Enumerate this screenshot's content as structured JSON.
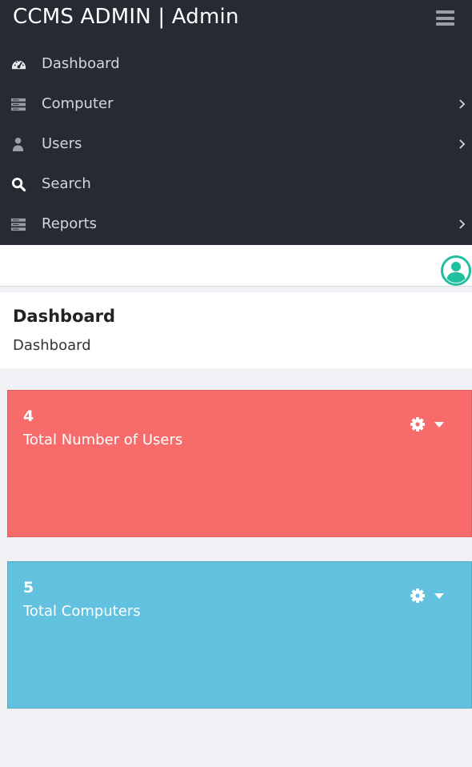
{
  "app": {
    "brand": "CCMS ADMIN | Admin"
  },
  "nav": {
    "items": [
      {
        "label": "Dashboard",
        "icon": "dashboard-icon"
      },
      {
        "label": "Computer",
        "icon": "server-icon",
        "has_submenu": true
      },
      {
        "label": "Users",
        "icon": "user-icon",
        "has_submenu": true
      },
      {
        "label": "Search",
        "icon": "search-icon"
      },
      {
        "label": "Reports",
        "icon": "server-icon",
        "has_submenu": true
      }
    ]
  },
  "topbar": {
    "avatar_icon": "user-circle-icon",
    "avatar_color": "#1fbfa0"
  },
  "page": {
    "title": "Dashboard",
    "breadcrumb": "Dashboard"
  },
  "cards": [
    {
      "value": "4",
      "label": "Total Number of Users",
      "color": "#f76b6b",
      "menu_icon": "gear-icon"
    },
    {
      "value": "5",
      "label": "Total Computers",
      "color": "#62c1de",
      "menu_icon": "gear-icon"
    }
  ]
}
